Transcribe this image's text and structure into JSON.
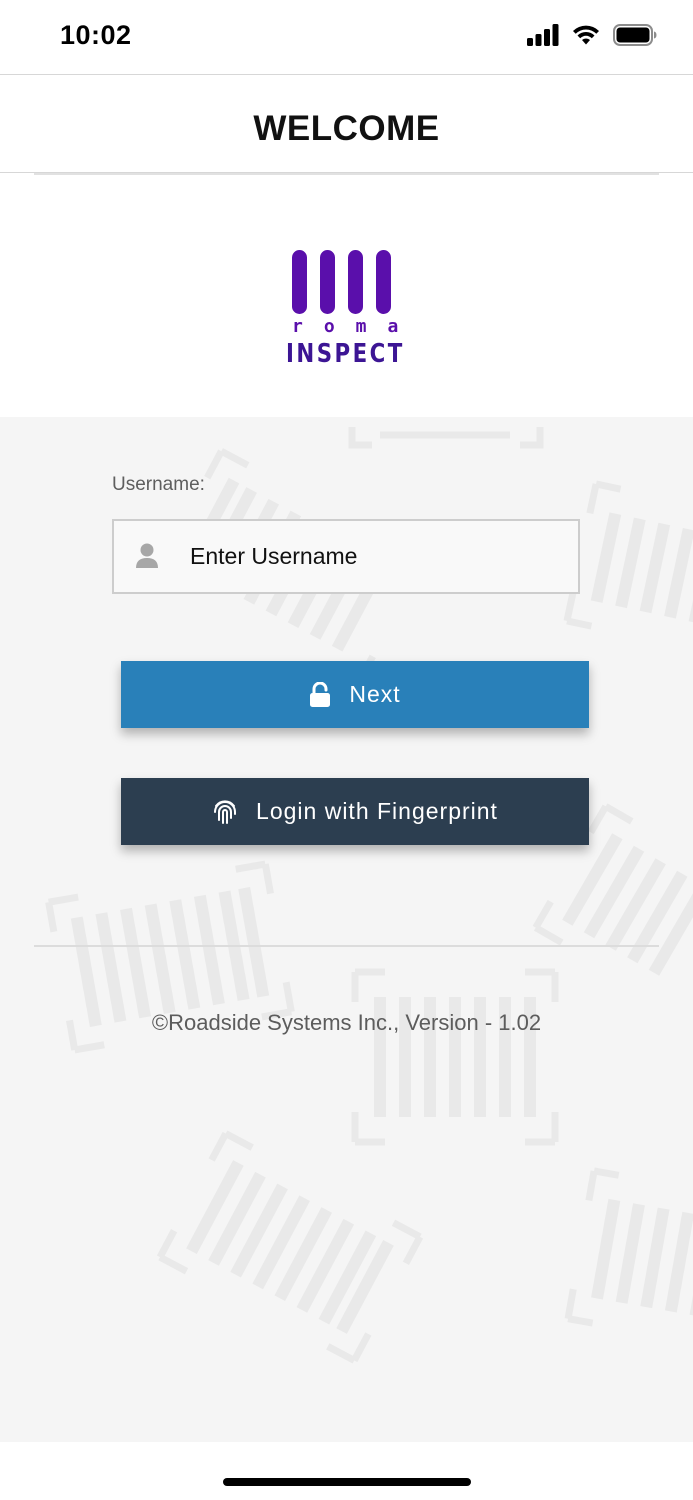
{
  "status_bar": {
    "time": "10:02",
    "icons": [
      "cellular-signal-icon",
      "wifi-icon",
      "battery-icon"
    ]
  },
  "header": {
    "title": "WELCOME"
  },
  "logo": {
    "small_text": "roma",
    "big_text": "INSPECT",
    "color": "#5a0fab"
  },
  "login": {
    "username_label": "Username:",
    "username_placeholder": "Enter Username",
    "username_value": "",
    "user_icon": "user-icon",
    "next_label": "Next",
    "next_icon": "unlock-icon",
    "fingerprint_label": "Login with Fingerprint",
    "fingerprint_icon": "fingerprint-icon"
  },
  "footer": {
    "copyright": "©Roadside Systems Inc., Version - 1.02"
  },
  "colors": {
    "next_button": "#2980b9",
    "fingerprint_button": "#2c3e50",
    "content_background": "#f5f5f5"
  }
}
